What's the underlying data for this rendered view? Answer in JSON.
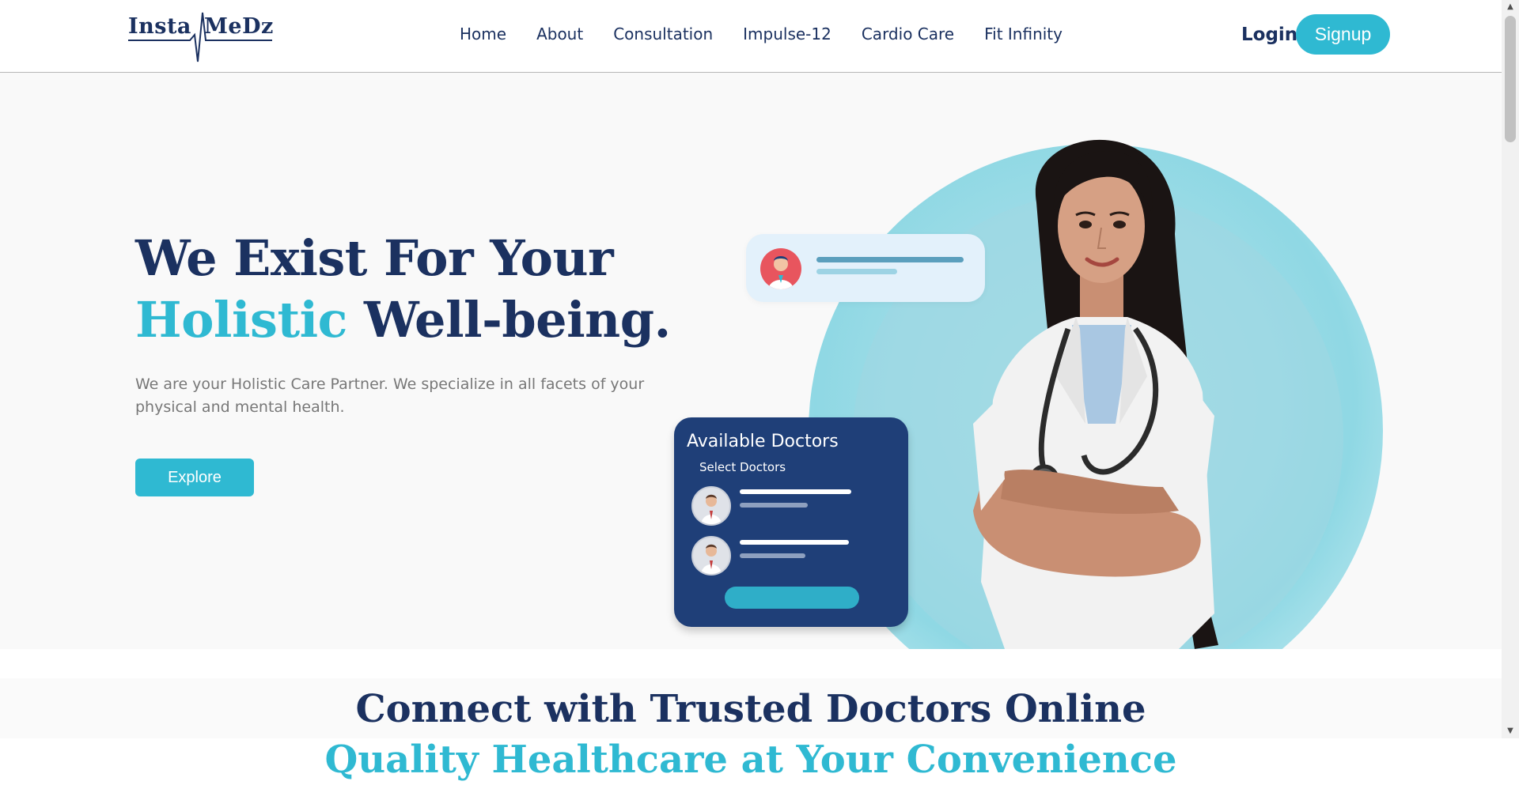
{
  "brand": {
    "logo_left": "Insta",
    "logo_right": "MeDz"
  },
  "nav": {
    "items": [
      "Home",
      "About",
      "Consultation",
      "Impulse-12",
      "Cardio Care",
      "Fit Infinity"
    ]
  },
  "auth": {
    "login_label": "Login",
    "signup_label": "Signup"
  },
  "hero": {
    "title_line1": "We Exist For Your",
    "title_accent": "Holistic",
    "title_rest": " Well-being.",
    "description": "We are your Holistic Care Partner. We specialize in all facets of your physical and mental health.",
    "explore_label": "Explore"
  },
  "doctors_card": {
    "title": "Available Doctors",
    "subtitle": "Select Doctors"
  },
  "section2": {
    "title": "Connect with Trusted Doctors Online",
    "subtitle": "Quality Healthcare at Your Convenience"
  },
  "colors": {
    "navy": "#1b3160",
    "accent": "#2fb9d2",
    "card_navy": "#1f3f78",
    "hero_bg": "#f9f9f9"
  },
  "icons": [
    "heartbeat-line-icon",
    "doctor-avatar-icon",
    "scroll-up-arrow-icon",
    "scroll-down-arrow-icon"
  ]
}
